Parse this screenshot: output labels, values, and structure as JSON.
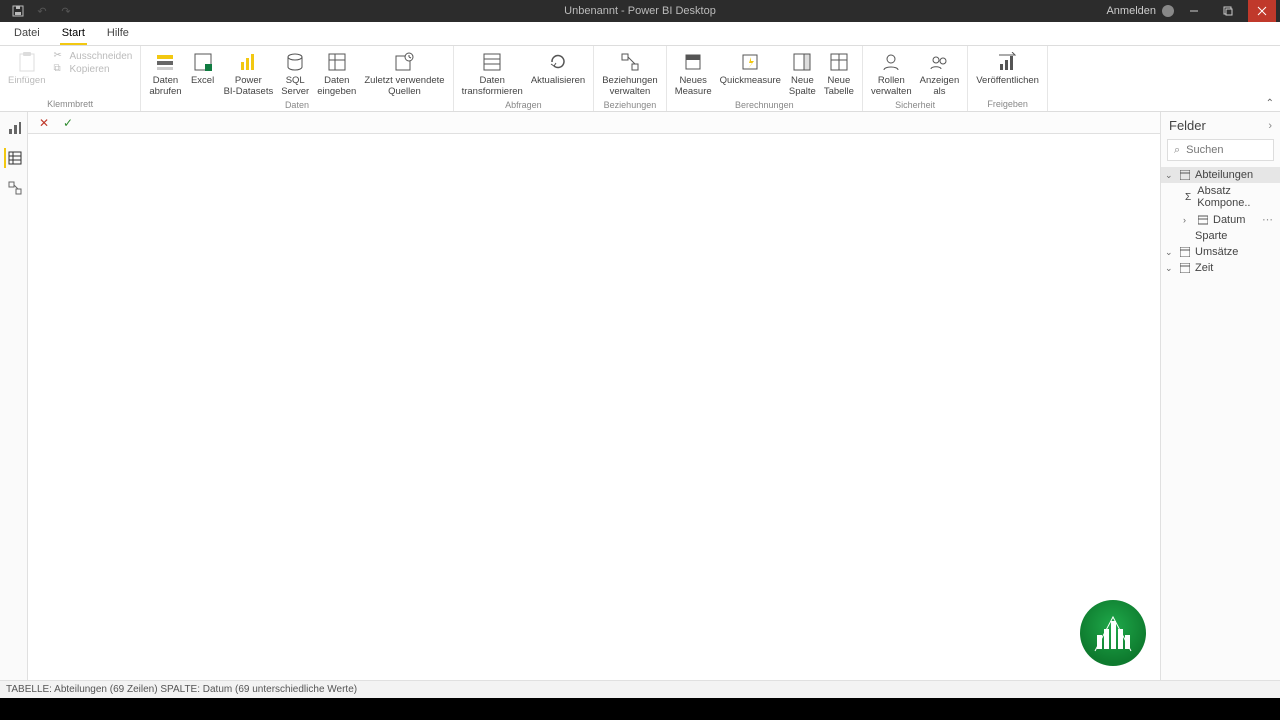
{
  "title": "Unbenannt - Power BI Desktop",
  "signin": "Anmelden",
  "tabs": {
    "file": "Datei",
    "start": "Start",
    "help": "Hilfe"
  },
  "ribbon": {
    "clipboard": {
      "label": "Klemmbrett",
      "paste": "Einfügen",
      "cut": "Ausschneiden",
      "copy": "Kopieren"
    },
    "data": {
      "label": "Daten",
      "get": "Daten\nabrufen",
      "excel": "Excel",
      "pbi": "Power\nBI-Datasets",
      "sql": "SQL\nServer",
      "enter": "Daten\neingeben",
      "recent": "Zuletzt verwendete\nQuellen"
    },
    "queries": {
      "label": "Abfragen",
      "transform": "Daten\ntransformieren",
      "refresh": "Aktualisieren"
    },
    "relations": {
      "label": "Beziehungen",
      "manage": "Beziehungen\nverwalten"
    },
    "calc": {
      "label": "Berechnungen",
      "measure": "Neues\nMeasure",
      "quick": "Quickmeasure",
      "col": "Neue\nSpalte",
      "table": "Neue\nTabelle"
    },
    "security": {
      "label": "Sicherheit",
      "roles": "Rollen\nverwalten",
      "viewas": "Anzeigen\nals"
    },
    "share": {
      "label": "Freigeben",
      "publish": "Veröffentlichen"
    }
  },
  "fields": {
    "title": "Felder",
    "search_ph": "Suchen",
    "tables": {
      "abteilungen": "Abteilungen",
      "absatz": "Absatz Kompone..",
      "datum": "Datum",
      "sparte": "Sparte",
      "umsaetze": "Umsätze",
      "zeit": "Zeit"
    }
  },
  "status": "TABELLE: Abteilungen (69 Zeilen)  SPALTE: Datum (69 unterschiedliche Werte)"
}
